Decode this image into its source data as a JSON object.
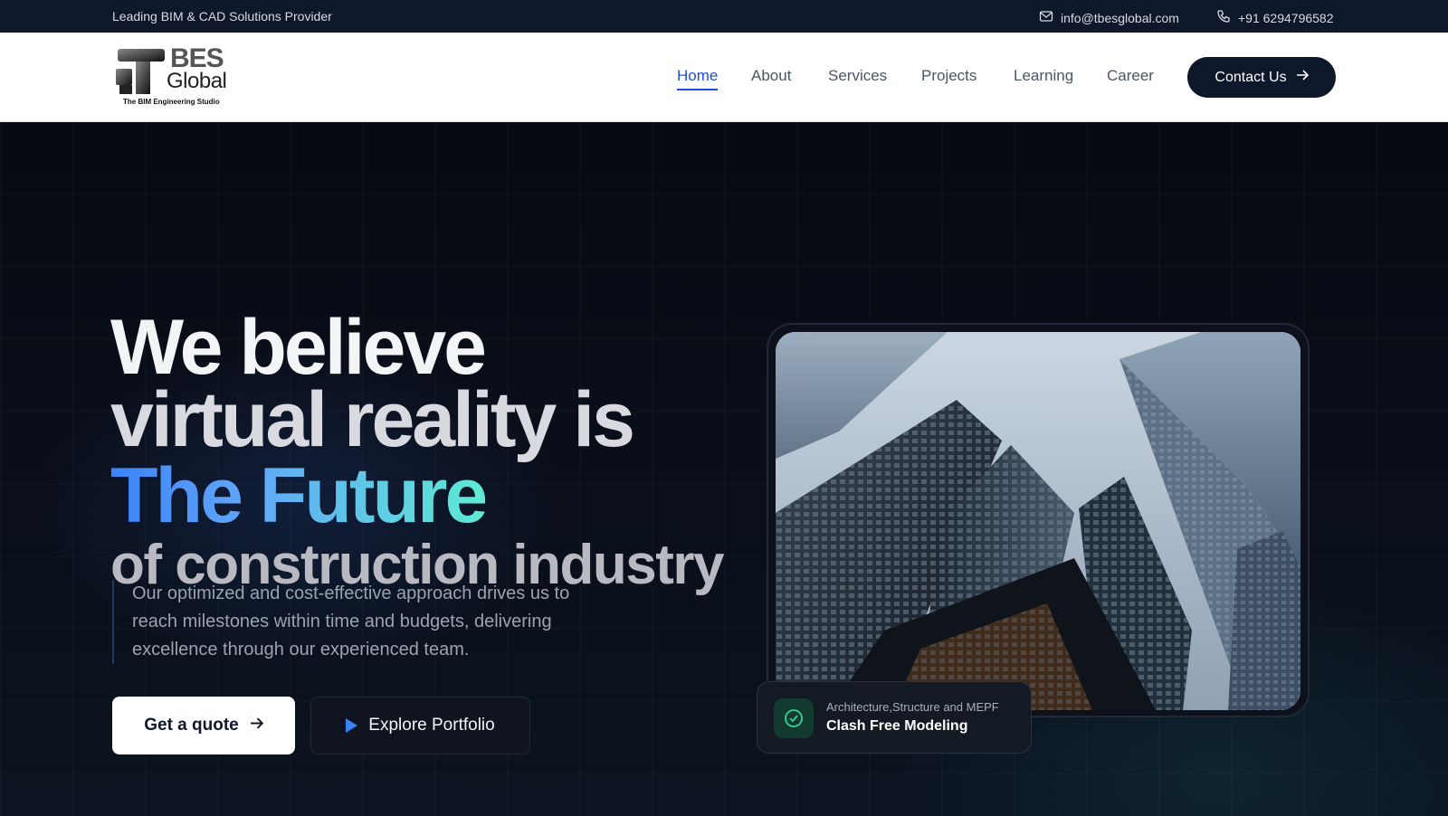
{
  "topbar": {
    "tagline": "Leading BIM & CAD Solutions Provider",
    "email": "info@tbesglobal.com",
    "phone": "+91 6294796582"
  },
  "logo": {
    "line1": "BES",
    "line2": "Global",
    "subtitle": "The BIM Engineering Studio"
  },
  "nav": {
    "items": [
      {
        "label": "Home",
        "active": true
      },
      {
        "label": "About"
      },
      {
        "label": "Services"
      },
      {
        "label": "Projects"
      },
      {
        "label": "Learning"
      },
      {
        "label": "Career"
      }
    ],
    "contact_label": "Contact Us"
  },
  "hero": {
    "headline_line1": "We believe",
    "headline_line2": "virtual reality is",
    "headline_highlight": "The Future",
    "headline_line4": "of construction industry",
    "subtext": "Our optimized and cost-effective approach drives us to reach milestones within time and budgets, delivering excellence through our experienced team.",
    "quote_label": "Get a quote",
    "portfolio_label": "Explore Portfolio"
  },
  "badge": {
    "line1": "Architecture,Structure and MEPF",
    "line2": "Clash Free Modeling"
  },
  "colors": {
    "accent": "#1d4ed8",
    "dark": "#0f172a",
    "gradient_start": "#3b82f6",
    "gradient_end": "#5eead4"
  }
}
